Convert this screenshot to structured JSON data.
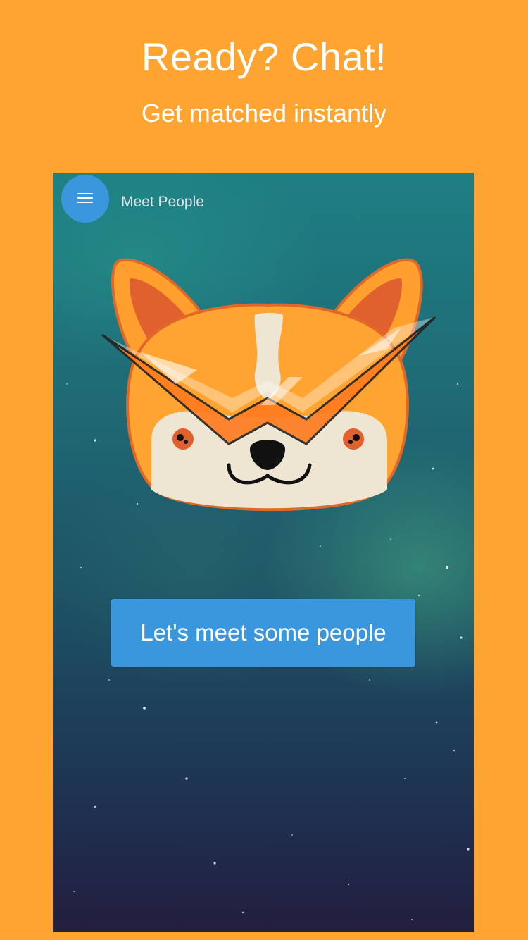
{
  "promo": {
    "headline": "Ready? Chat!",
    "subline": "Get matched instantly"
  },
  "app": {
    "title": "Meet People",
    "menu_icon": "hamburger-menu-icon",
    "cta_label": "Let's meet some people",
    "mascot": "fox-mascot-with-visor"
  },
  "colors": {
    "background": "#FFA430",
    "accent": "#3a97dd"
  }
}
